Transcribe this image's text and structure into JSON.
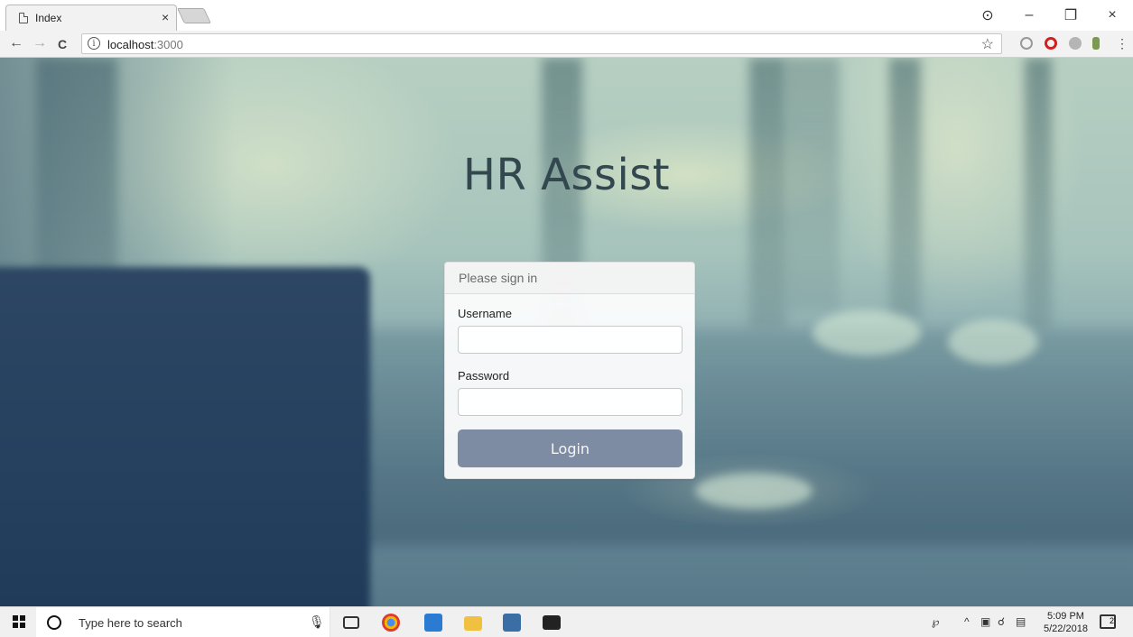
{
  "browser": {
    "tab_title": "Index",
    "tab_close": "×",
    "url_host": "localhost",
    "url_port": ":3000",
    "window_controls": {
      "account": "⊙",
      "minimize": "–",
      "restore": "❐",
      "close": "×"
    },
    "nav": {
      "back": "←",
      "forward": "→",
      "reload": "C"
    },
    "star": "☆"
  },
  "page": {
    "title": "HR Assist",
    "panel_heading": "Please sign in",
    "username_label": "Username",
    "password_label": "Password",
    "username_value": "",
    "password_value": "",
    "login_label": "Login",
    "login_button_color": "#7d8ca3"
  },
  "taskbar": {
    "search_placeholder": "Type here to search",
    "time": "5:09 PM",
    "date": "5/22/2018",
    "notification_count": "2"
  },
  "icons": {
    "tab": "page-icon",
    "info": "info-icon",
    "star": "star-icon",
    "start": "windows-icon",
    "search": "cortana-icon",
    "mic": "microphone-icon"
  }
}
